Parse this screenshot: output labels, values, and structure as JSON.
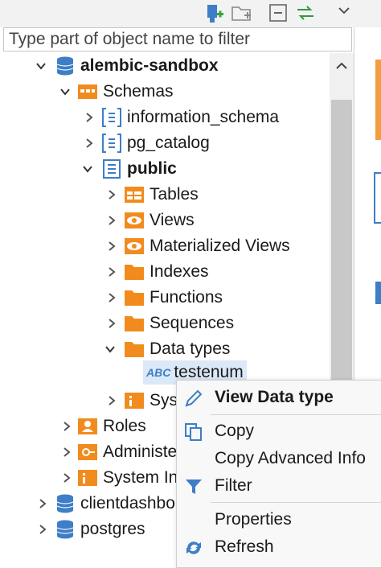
{
  "filter": {
    "placeholder": "Type part of object name to filter"
  },
  "tree": {
    "connection": "alembic-sandbox",
    "schemas_folder": "Schemas",
    "schemas": [
      "information_schema",
      "pg_catalog",
      "public"
    ],
    "public_children": [
      "Tables",
      "Views",
      "Materialized Views",
      "Indexes",
      "Functions",
      "Sequences",
      "Data types"
    ],
    "datatype_item": "testenum",
    "datatype_badge": "ABC",
    "system_info_partial": "Sys",
    "roles": "Roles",
    "administer": "Administe",
    "system_info": "System In",
    "other_connections": [
      "clientdashbo",
      "postgres"
    ]
  },
  "context_menu": {
    "view_data_type": "View Data type",
    "copy": "Copy",
    "copy_advanced": "Copy Advanced Info",
    "filter": "Filter",
    "properties": "Properties",
    "refresh": "Refresh"
  },
  "colors": {
    "accent_orange": "#f28b1e",
    "db_blue": "#3d7ec6",
    "selection": "#dbe8f8"
  }
}
